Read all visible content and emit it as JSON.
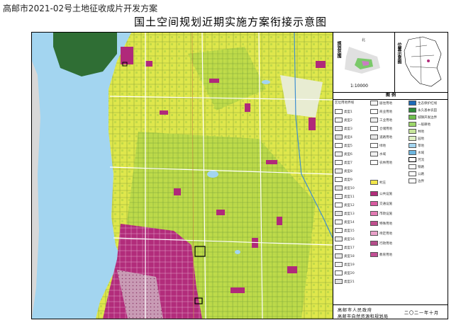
{
  "header": {
    "project_title": "高邮市2021-02号土地征收成片开发方案",
    "map_title": "国土空间规划近期实施方案衔接示意图"
  },
  "scale_panel": {
    "left_label": "规划范围",
    "right_label": "位置示意图",
    "scale_text": "1:10000"
  },
  "legend": {
    "heading": "图    例",
    "col1": [
      "区位用地界线",
      "类型1",
      "类型2",
      "类型3",
      "类型4",
      "类型5",
      "类型6",
      "类型7",
      "类型8",
      "类型9",
      "类型10",
      "类型11",
      "类型12",
      "类型13",
      "类型14",
      "类型15",
      "类型16",
      "类型17",
      "类型18",
      "类型19",
      "类型20",
      "类型21"
    ],
    "col2": [
      "居住用地",
      "商业用地",
      "工业用地",
      "仓储用地",
      "道路用地",
      "绿地",
      "水域",
      "农林用地",
      "村庄",
      "公共设施",
      "交通设施",
      "市政设施",
      "特殊用地",
      "待定用地",
      "行政用地",
      "教育用地"
    ],
    "col3": [
      "生态保护红线",
      "永久基本农田",
      "城镇开发边界",
      "一般耕地",
      "林地",
      "园地",
      "草地",
      "水域",
      "河流",
      "铁路",
      "公路",
      "边界"
    ]
  },
  "footer": {
    "org1": "高邮市人民政府",
    "org2": "高邮市自然资源和规划局",
    "date": "二〇二一年十月"
  },
  "colors": {
    "water": "#a3d5f0",
    "urban_yellow": "#e4e94d",
    "agri_green": "#b7d84b",
    "magenta": "#b42a7a",
    "dark_green": "#2f6e34"
  }
}
